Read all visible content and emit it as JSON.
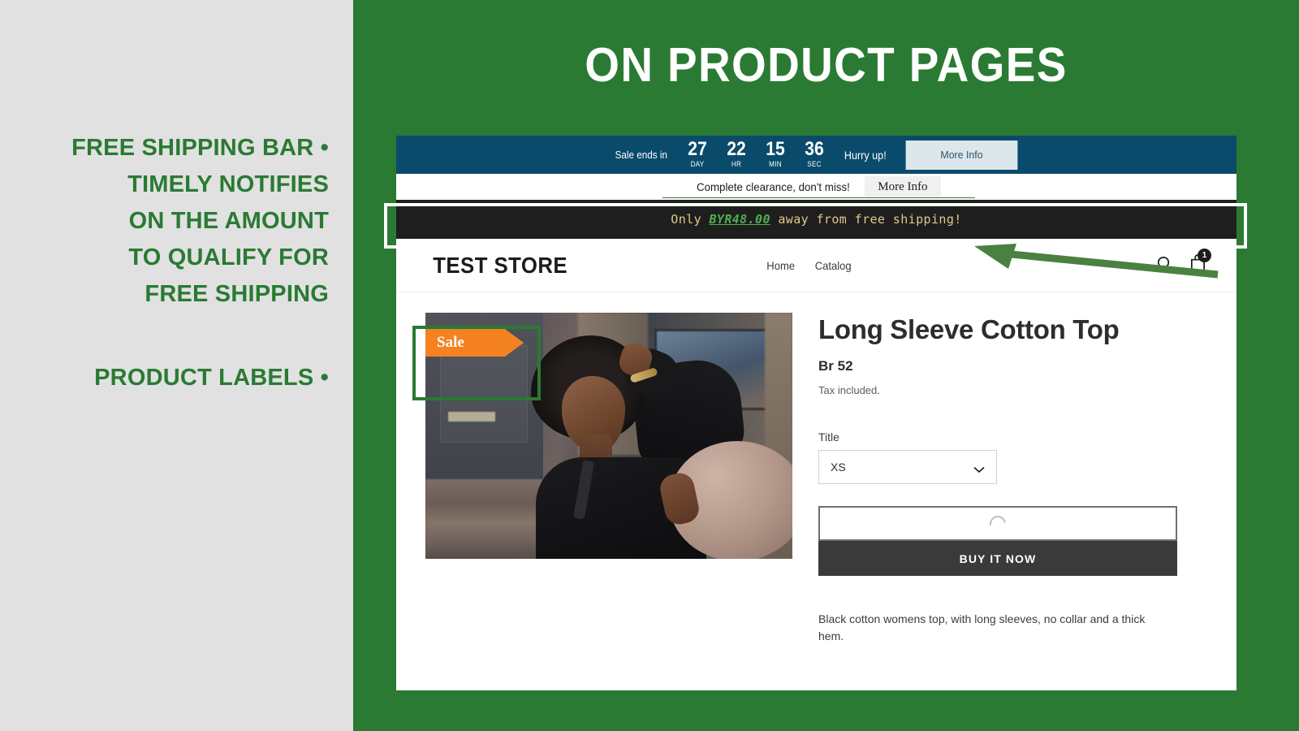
{
  "slide": {
    "title": "ON PRODUCT PAGES",
    "green": "#2a7a33",
    "panel_bg": "#e1e1e1"
  },
  "annotations": [
    {
      "id": "free-shipping-bar",
      "lines": [
        "FREE SHIPPING BAR  •",
        "TIMELY NOTIFIES",
        "ON THE AMOUNT",
        "TO QUALIFY FOR",
        "FREE SHIPPING"
      ]
    },
    {
      "id": "product-labels",
      "lines": [
        "PRODUCT LABELS  •"
      ]
    }
  ],
  "countdown_bar": {
    "bg": "#0a4b6b",
    "label": "Sale ends in",
    "units": [
      {
        "value": "27",
        "unit": "DAY"
      },
      {
        "value": "22",
        "unit": "HR"
      },
      {
        "value": "15",
        "unit": "MIN"
      },
      {
        "value": "36",
        "unit": "SEC"
      }
    ],
    "hurry": "Hurry up!",
    "button": "More Info"
  },
  "promo_strip": {
    "text": "Complete clearance, don't miss!",
    "button": "More Info"
  },
  "free_shipping_bar": {
    "bg": "#1e1e1e",
    "prefix": "Only ",
    "amount": "BYR48.00",
    "suffix": " away from free shipping!",
    "amount_color": "#4fae4f",
    "text_color": "#e4c98a"
  },
  "store_header": {
    "logo": "TEST STORE",
    "nav": [
      "Home",
      "Catalog"
    ],
    "search_icon": "search-icon",
    "cart_icon": "shopping-bag-icon",
    "cart_count": "1"
  },
  "product": {
    "label_badge": "Sale",
    "label_color": "#f58220",
    "title": "Long Sleeve Cotton Top",
    "price": "Br 52",
    "tax_note": "Tax included.",
    "variant_label": "Title",
    "variant_value": "XS",
    "variant_options": [
      "XS"
    ],
    "add_to_cart_state": "loading",
    "buy_now_label": "BUY IT NOW",
    "description": "Black cotton womens top, with long sleeves, no collar and a thick hem."
  }
}
